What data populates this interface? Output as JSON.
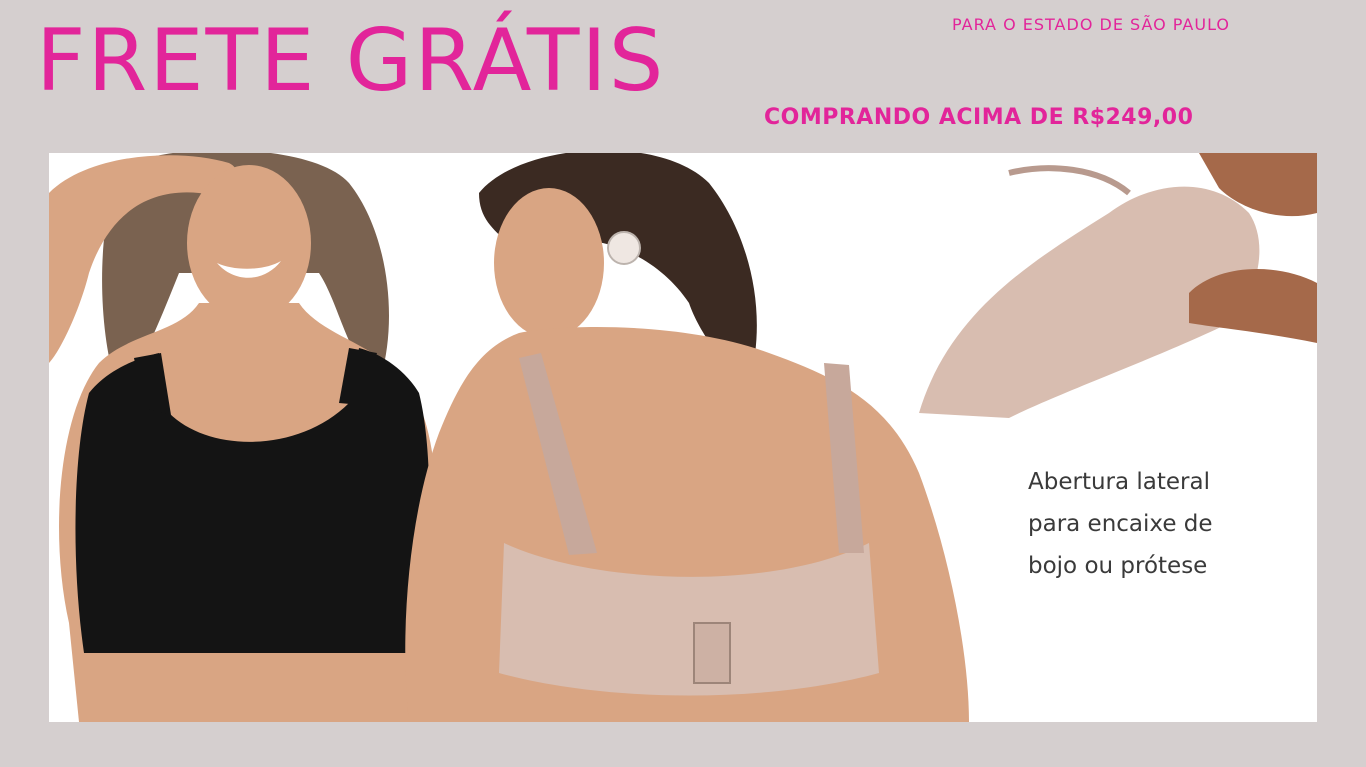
{
  "banner": {
    "title": "FRETE GRÁTIS",
    "region_note": "PARA O ESTADO DE SÃO PAULO",
    "min_purchase": "COMPRANDO ACIMA DE R$249,00"
  },
  "feature_caption": {
    "line1": "Abertura lateral",
    "line2": "para encaixe de",
    "line3": "bojo ou prótese"
  },
  "colors": {
    "background": "#d5cfcf",
    "accent_pink": "#e2259a",
    "black_bra": "#141414",
    "nude_bra": "#d8bdb0",
    "skin": "#d9a583",
    "hair_dark": "#3b2a22",
    "hair_light": "#7a6250"
  }
}
